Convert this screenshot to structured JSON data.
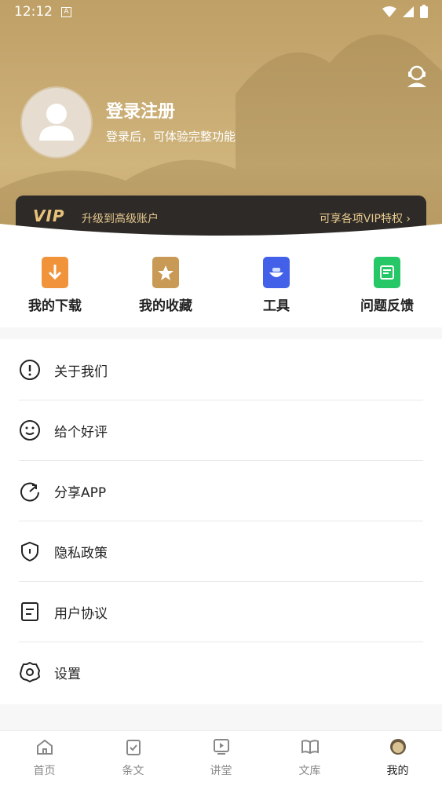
{
  "status_bar": {
    "time": "12:12",
    "notification_letter": "A"
  },
  "profile": {
    "title": "登录注册",
    "subtitle": "登录后，可体验完整功能"
  },
  "vip": {
    "logo": "VIP",
    "text": "升级到高级账户",
    "cta": "可享各项VIP特权 ›"
  },
  "quick_actions": [
    {
      "label": "我的下载",
      "icon": "download-icon",
      "color": "#f0933a"
    },
    {
      "label": "我的收藏",
      "icon": "star-icon",
      "color": "#c99a55"
    },
    {
      "label": "工具",
      "icon": "tools-icon",
      "color": "#4361e8"
    },
    {
      "label": "问题反馈",
      "icon": "feedback-icon",
      "color": "#25c767"
    }
  ],
  "menu": [
    {
      "label": "关于我们",
      "icon": "info-icon"
    },
    {
      "label": "给个好评",
      "icon": "smile-icon"
    },
    {
      "label": "分享APP",
      "icon": "share-icon"
    },
    {
      "label": "隐私政策",
      "icon": "shield-icon"
    },
    {
      "label": "用户协议",
      "icon": "document-icon"
    },
    {
      "label": "设置",
      "icon": "gear-icon"
    }
  ],
  "tabs": [
    {
      "label": "首页",
      "icon": "home-icon"
    },
    {
      "label": "条文",
      "icon": "clipboard-icon"
    },
    {
      "label": "讲堂",
      "icon": "play-icon"
    },
    {
      "label": "文库",
      "icon": "book-icon"
    },
    {
      "label": "我的",
      "icon": "profile-icon",
      "active": true
    }
  ]
}
